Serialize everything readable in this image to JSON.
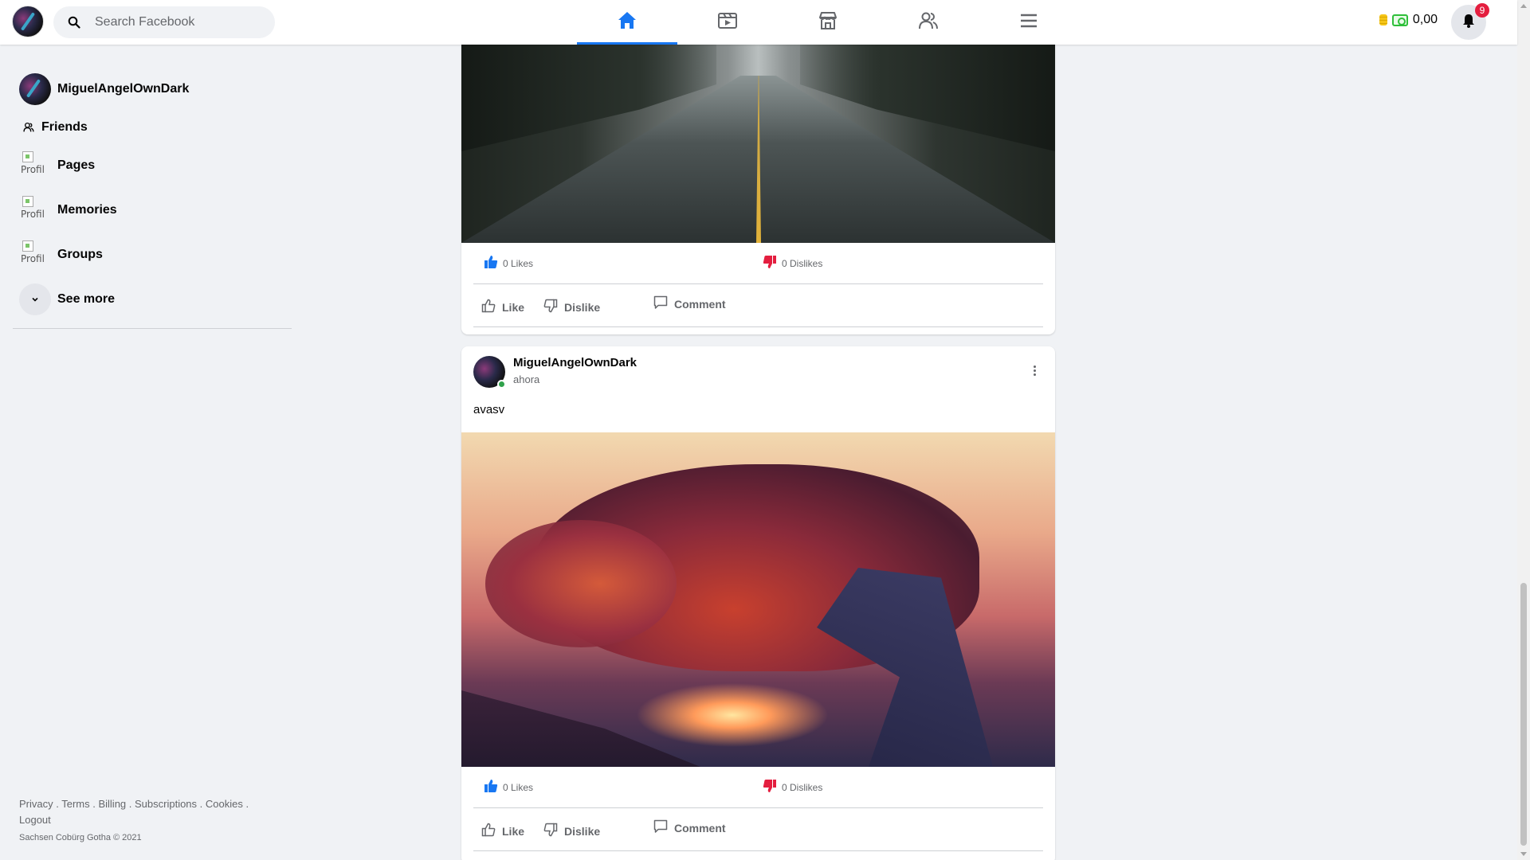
{
  "header": {
    "search_placeholder": "Search Facebook",
    "nav_tabs": [
      "home",
      "watch",
      "marketplace",
      "friends",
      "menu"
    ],
    "active_tab": "home",
    "wallet_amount": "0,00",
    "notification_count": "9"
  },
  "sidebar": {
    "profile_name": "MiguelAngelOwnDark",
    "items": [
      {
        "label": "Friends",
        "icon": "friends-icon"
      },
      {
        "label": "Pages",
        "icon": "broken-image-icon",
        "alt": "Profil"
      },
      {
        "label": "Memories",
        "icon": "broken-image-icon",
        "alt": "Profil"
      },
      {
        "label": "Groups",
        "icon": "broken-image-icon",
        "alt": "Profil"
      }
    ],
    "see_more": "See more"
  },
  "footer": {
    "links": [
      "Privacy",
      "Terms",
      "Billing",
      "Subscriptions",
      "Cookies",
      "Logout"
    ],
    "copyright": "Sachsen Cobürg Gotha © 2021"
  },
  "posts": [
    {
      "likes": "0 Likes",
      "dislikes": "0 Dislikes",
      "like_label": "Like",
      "dislike_label": "Dislike",
      "comment_label": "Comment"
    },
    {
      "author": "MiguelAngelOwnDark",
      "time": "ahora",
      "text": "avasv",
      "likes": "0 Likes",
      "dislikes": "0 Dislikes",
      "like_label": "Like",
      "dislike_label": "Dislike",
      "comment_label": "Comment"
    }
  ],
  "colors": {
    "accent": "#1877f2",
    "like_blue": "#1877f2",
    "dislike_red": "#e41e3f",
    "online_green": "#31a24c"
  }
}
